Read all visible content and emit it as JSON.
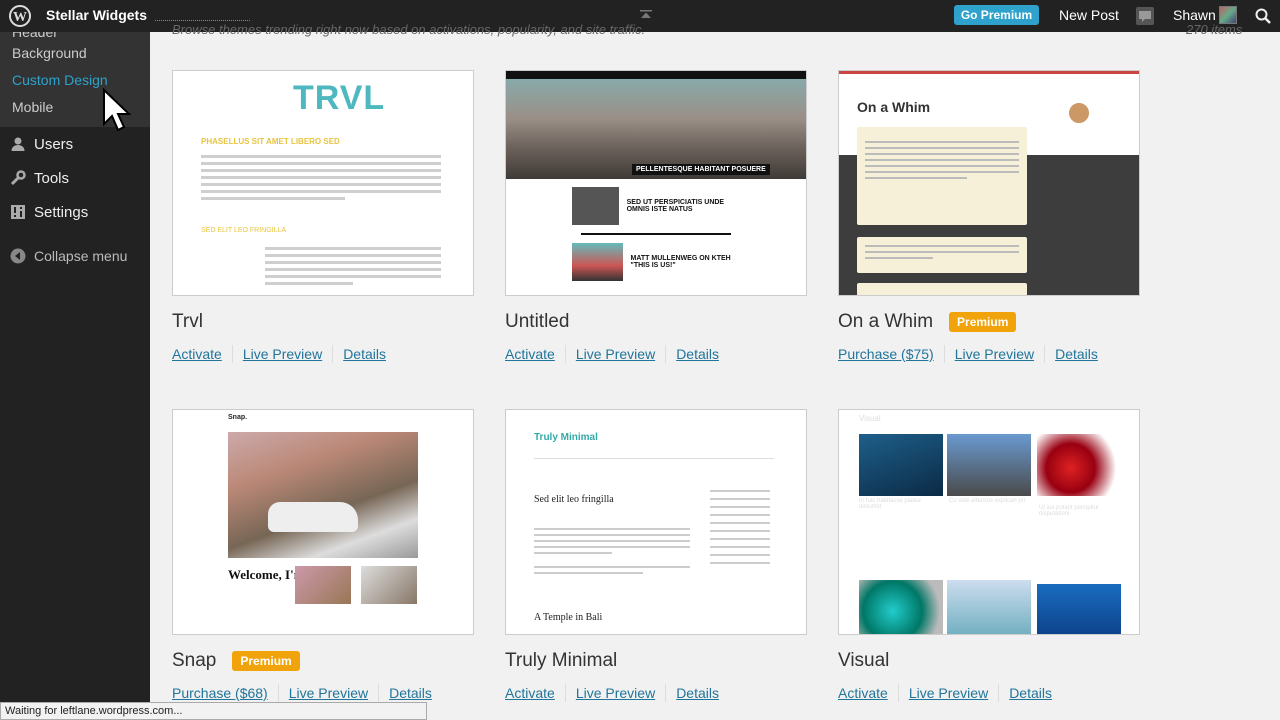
{
  "adminbar": {
    "site_name": "Stellar Widgets",
    "go_premium": "Go Premium",
    "new_post": "New Post",
    "user_name": "Shawn"
  },
  "sidebar": {
    "partial_item": "Header",
    "sub_items": [
      "Background",
      "Custom Design",
      "Mobile"
    ],
    "menu": [
      {
        "label": "Users",
        "icon": "users-icon"
      },
      {
        "label": "Tools",
        "icon": "tools-icon"
      },
      {
        "label": "Settings",
        "icon": "settings-icon"
      }
    ],
    "collapse": "Collapse menu"
  },
  "main": {
    "subtitle": "Browse themes trending right now based on activations, popularity, and site traffic.",
    "count": "270 items"
  },
  "themes": [
    {
      "name": "Trvl",
      "actions": [
        "Activate",
        "Live Preview",
        "Details"
      ]
    },
    {
      "name": "Untitled",
      "actions": [
        "Activate",
        "Live Preview",
        "Details"
      ]
    },
    {
      "name": "On a Whim",
      "badge": "Premium",
      "actions": [
        "Purchase ($75)",
        "Live Preview",
        "Details"
      ]
    },
    {
      "name": "Snap",
      "badge": "Premium",
      "actions": [
        "Purchase ($68)",
        "Live Preview",
        "Details"
      ]
    },
    {
      "name": "Truly Minimal",
      "actions": [
        "Activate",
        "Live Preview",
        "Details"
      ]
    },
    {
      "name": "Visual",
      "actions": [
        "Activate",
        "Live Preview",
        "Details"
      ]
    }
  ],
  "thumbs": {
    "trvl_logo": "TRVL",
    "trvl_heading": "PHASELLUS SIT AMET LIBERO SED",
    "trvl_heading2": "SED ELIT LEO FRINGILLA",
    "untitled_label": "PELLENTESQUE HABITANT POSUERE",
    "untitled_post1": "SED UT PERSPICIATIS UNDE OMNIS ISTE NATUS",
    "untitled_post2": "MATT MULLENWEG ON KTEH \"THIS IS US!\"",
    "whim_title": "On a Whim",
    "snap_nav": "Snap.",
    "snap_welcome": "Welcome, I'm Snap.",
    "minimal_logo": "Truly Minimal",
    "minimal_h1": "Sed elit leo fringilla",
    "minimal_h2": "A Temple in Bali",
    "visual_logo": "Visual",
    "visual_t1": "In hac habitasse platea dictumst",
    "visual_t2": "Cu vide albucius explicari pri",
    "visual_t3": "Ut ius putant percipitur disputationi"
  },
  "status": "Waiting for leftlane.wordpress.com..."
}
